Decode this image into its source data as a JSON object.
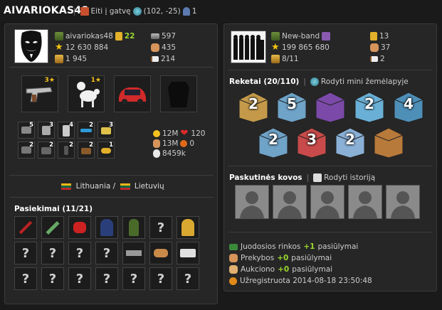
{
  "header": {
    "player_name": "AIVARIOKAS48",
    "go_street": "Eiti į gatvę",
    "coords": "(102, -25)",
    "people_count": "1"
  },
  "profile": {
    "username": "aivariokas48",
    "level": "22",
    "money": "12 630 884",
    "respect": "1 945",
    "stat_a": "597",
    "stat_b": "435",
    "stat_c": "214"
  },
  "equipment": {
    "slots": [
      {
        "name": "pistol",
        "stars": "3★"
      },
      {
        "name": "poodle",
        "stars": "1★"
      },
      {
        "name": "car",
        "stars": ""
      },
      {
        "name": "armor",
        "stars": ""
      }
    ]
  },
  "inventory": {
    "items": [
      {
        "name": "laptop",
        "count": "5"
      },
      {
        "name": "jacket",
        "count": "3"
      },
      {
        "name": "fridge",
        "count": "4"
      },
      {
        "name": "sunglasses",
        "count": "2"
      },
      {
        "name": "camera",
        "count": "3"
      },
      {
        "name": "wrench",
        "count": "2"
      },
      {
        "name": "case",
        "count": "2"
      },
      {
        "name": "phone",
        "count": "2"
      },
      {
        "name": "boots",
        "count": "2"
      },
      {
        "name": "knuckles",
        "count": "1"
      }
    ],
    "extra": {
      "sun": "12M",
      "health": "120",
      "power": "13M",
      "energy": "0",
      "cash": "8459k"
    }
  },
  "language": {
    "country": "Lithuania",
    "separator": "/",
    "lang": "Lietuvių"
  },
  "achievements": {
    "title": "Pasiekimai (11/21)",
    "rows": [
      [
        "sword",
        "syringe",
        "gloves",
        "hooded-man",
        "soldier",
        "?",
        "mechanic"
      ],
      [
        "?",
        "?",
        "?",
        "?",
        "gun",
        "dog",
        "van"
      ],
      [
        "?",
        "?",
        "?",
        "?",
        "?",
        "?",
        "?"
      ]
    ],
    "locked_mark": "?"
  },
  "gang": {
    "name": "New-band",
    "members": "199 865 680",
    "count": "8/11",
    "stat_a": "13",
    "stat_b": "37",
    "stat_c": "2"
  },
  "racket": {
    "title": "Reketai (20/110)",
    "map_link": "Rodyti mini žemėlapyje",
    "buildings": [
      {
        "label": "2",
        "color": "#c49a4a"
      },
      {
        "label": "5",
        "color": "#6fa3c8"
      },
      {
        "label": "",
        "color": "#7b4aa8"
      },
      {
        "label": "2",
        "color": "#6ab0d6"
      },
      {
        "label": "4",
        "color": "#4e8fb8"
      },
      {
        "label": "2",
        "color": "#6fa3c8"
      },
      {
        "label": "3",
        "color": "#c84a4a"
      },
      {
        "label": "2",
        "color": "#8ab0d6"
      },
      {
        "label": "",
        "color": "#b87a3a"
      }
    ]
  },
  "fights": {
    "title": "Paskutinės kovos",
    "history_link": "Rodyti istoriją",
    "slots": 5
  },
  "offers": {
    "black_market_label": "Juodosios rinkos",
    "black_market_value": "+1",
    "black_market_suffix": "pasiūlymai",
    "trade_label": "Prekybos",
    "trade_value": "+0",
    "trade_suffix": "pasiūlymai",
    "auction_label": "Aukciono",
    "auction_value": "+0",
    "auction_suffix": "pasiūlymai",
    "registered": "Užregistruota 2014-08-18 23:50:48"
  }
}
